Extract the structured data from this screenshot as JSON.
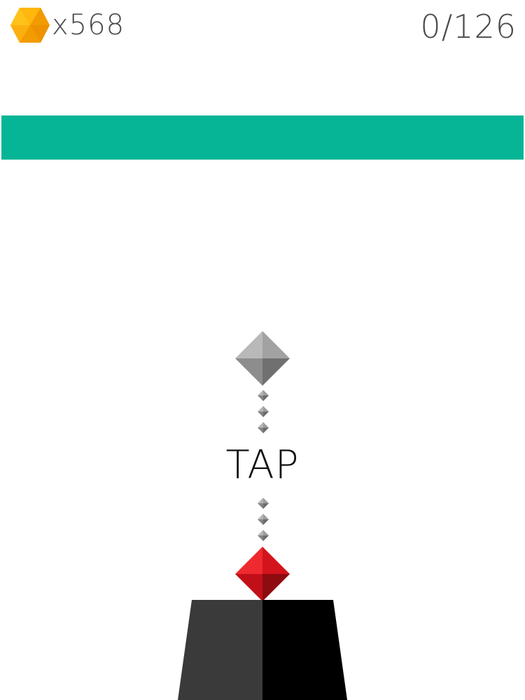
{
  "hud": {
    "coin_icon": "hexagon-coin-icon",
    "coin_color": "#f7a500",
    "coin_count": "x568",
    "progress": "0/126"
  },
  "game": {
    "target_bar_color": "#06b596",
    "target_gem_color": "#9c9c9c",
    "player_gem_color": "#d3141c",
    "pedestal_colors": [
      "#3a3a3a",
      "#000000"
    ],
    "tap_label": "TAP"
  }
}
